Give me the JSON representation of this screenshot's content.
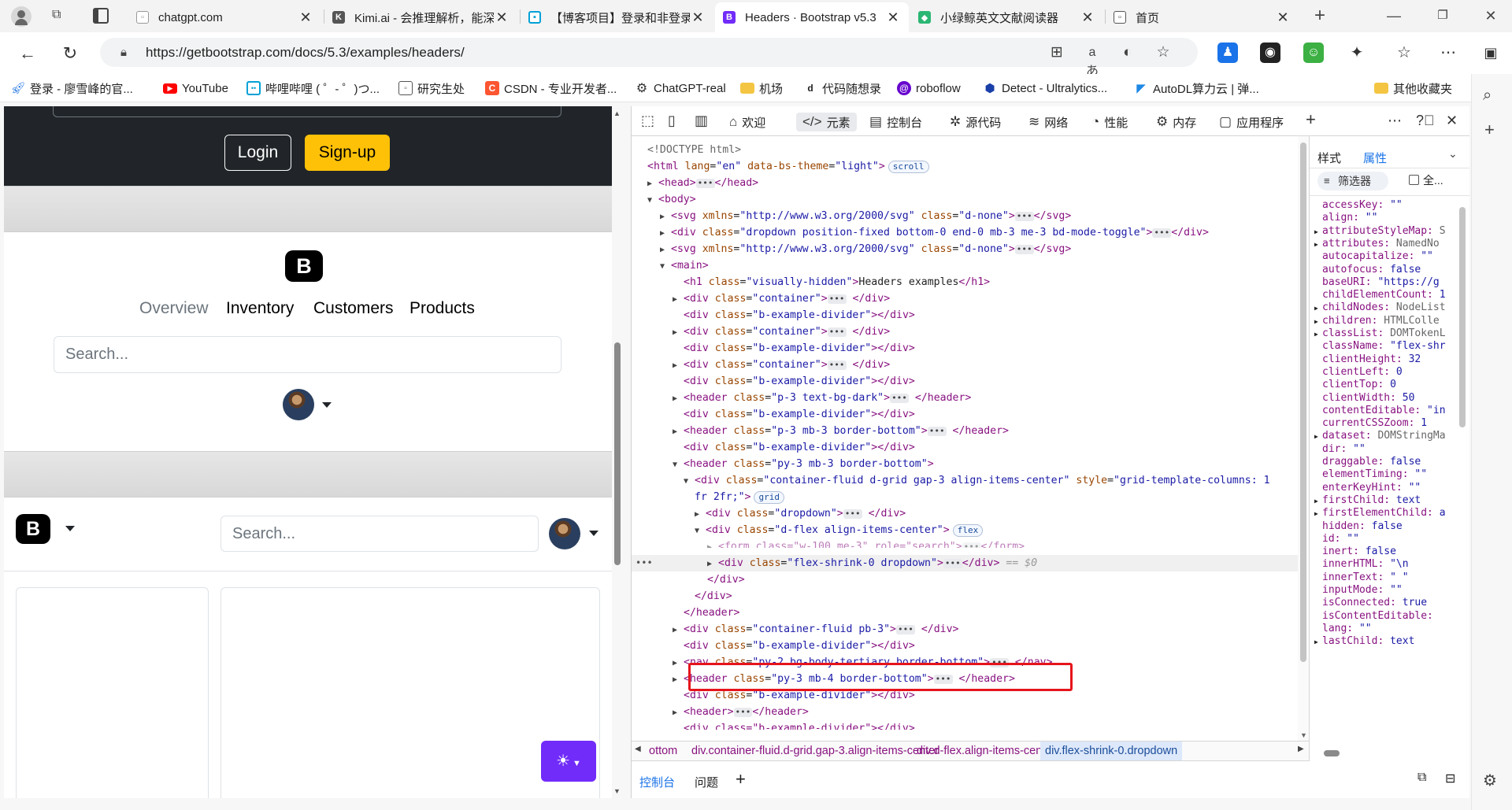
{
  "browser": {
    "tabs": [
      {
        "title": "chatgpt.com",
        "active": false
      },
      {
        "title": "Kimi.ai - 会推理解析，能深度思考",
        "active": false
      },
      {
        "title": "【博客项目】登录和非登录状态",
        "active": false
      },
      {
        "title": "Headers · Bootstrap v5.3",
        "active": true
      },
      {
        "title": "小绿鲸英文文献阅读器",
        "active": false
      },
      {
        "title": "首页",
        "active": false
      }
    ],
    "new_tab": "+",
    "url": "https://getbootstrap.com/docs/5.3/examples/headers/",
    "bookmarks": [
      "登录 - 廖雪峰的官...",
      "YouTube",
      "哔哩哔哩 ( ゜- ゜)つ...",
      "研究生处",
      "CSDN - 专业开发者...",
      "ChatGPT-real",
      "机场",
      "代码随想录",
      "roboflow",
      "Detect - Ultralytics...",
      "AutoDL算力云 | 弹...",
      "其他收藏夹"
    ]
  },
  "page": {
    "login_label": "Login",
    "signup_label": "Sign-up",
    "logo_letter": "B",
    "nav": [
      "Overview",
      "Inventory",
      "Customers",
      "Products"
    ],
    "search_placeholder": "Search...",
    "search_placeholder_2": "Search..."
  },
  "devtools": {
    "tabs": [
      "欢迎",
      "元素",
      "控制台",
      "源代码",
      "网络",
      "性能",
      "内存",
      "应用程序"
    ],
    "active_tab": "元素",
    "side_tabs": [
      "样式",
      "属性"
    ],
    "active_side_tab": "属性",
    "filter_label": "筛选器",
    "show_all_label": "全...",
    "breadcrumbs": [
      "ottom",
      "div.container-fluid.d-grid.gap-3.align-items-center",
      "div.d-flex.align-items-center",
      "div.flex-shrink-0.dropdown"
    ],
    "drawer_tabs": [
      "控制台",
      "问题"
    ],
    "dom_lines": {
      "l0": "<!DOCTYPE html>",
      "l1_tag": "<html",
      "l1_a1": "lang",
      "l1_v1": "\"en\"",
      "l1_a2": "data-bs-theme",
      "l1_v2": "\"light\"",
      "l1_end": ">",
      "l1_badge": "scroll",
      "l2": "<head>",
      "l2_end": "</head>",
      "l3": "<body>",
      "l4_tag": "<svg",
      "l4_a1": "xmlns",
      "l4_v1": "\"http://www.w3.org/2000/svg\"",
      "l4_a2": "class",
      "l4_v2": "\"d-none\"",
      "l4_end": "</svg>",
      "l5_tag": "<div",
      "l5_a1": "class",
      "l5_v1": "\"dropdown position-fixed bottom-0 end-0 mb-3 me-3 bd-mode-toggle\"",
      "l5_end": "</div>",
      "l6_tag": "<svg",
      "l6_a1": "xmlns",
      "l6_v1": "\"http://www.w3.org/2000/svg\"",
      "l6_a2": "class",
      "l6_v2": "\"d-none\"",
      "l6_end": "</svg>",
      "l7": "<main>",
      "l8_tag": "<h1",
      "l8_a1": "class",
      "l8_v1": "\"visually-hidden\"",
      "l8_text": "Headers examples",
      "l8_end": "</h1>",
      "container": "\"container\"",
      "divider": "\"b-example-divider\"",
      "div_open": "<div",
      "div_close": "</div>",
      "header_open": "<header",
      "header_close": "</header>",
      "cls": "class",
      "h1_v": "\"p-3 text-bg-dark\"",
      "h2_v": "\"p-3 mb-3 border-bottom\"",
      "h3_v": "\"py-3 mb-3 border-bottom\"",
      "grid_v": "\"container-fluid d-grid gap-3 align-items-center\"",
      "style_a": "style",
      "style_v1": "\"grid-template-columns: 1",
      "style_v2": "fr 2fr;\"",
      "grid_badge": "grid",
      "dd_v": "\"dropdown\"",
      "flex_v": "\"d-flex align-items-center\"",
      "flex_badge": "flex",
      "form_line": "<form class=\"w-100 me-3\" role=\"search\">",
      "form_end": "</form>",
      "sel_v": "\"flex-shrink-0 dropdown\"",
      "eq0": "== $0",
      "pb_v": "\"container-fluid pb-3\"",
      "nav_open": "<nav",
      "nav_close": "</nav>",
      "nav_v": "\"py-2 bg-body-tertiary border-bottom\"",
      "h4_v": "\"py-3 mb-4 border-bottom\"",
      "header_plain": "<header>",
      "last_line": "<div class=\"b-example-divider\"></div>"
    },
    "properties": [
      {
        "k": "accessKey",
        "v": "\"\"",
        "t": "s",
        "exp": false
      },
      {
        "k": "align",
        "v": "\"\"",
        "t": "s",
        "exp": false
      },
      {
        "k": "attributeStyleMap",
        "v": "S",
        "t": "o",
        "exp": true
      },
      {
        "k": "attributes",
        "v": "NamedNo",
        "t": "o",
        "exp": true
      },
      {
        "k": "autocapitalize",
        "v": "\"\"",
        "t": "s",
        "exp": false
      },
      {
        "k": "autofocus",
        "v": "false",
        "t": "n",
        "exp": false
      },
      {
        "k": "baseURI",
        "v": "\"https://g",
        "t": "s",
        "exp": false
      },
      {
        "k": "childElementCount",
        "v": "1",
        "t": "n",
        "exp": false
      },
      {
        "k": "childNodes",
        "v": "NodeList",
        "t": "o",
        "exp": true
      },
      {
        "k": "children",
        "v": "HTMLColle",
        "t": "o",
        "exp": true
      },
      {
        "k": "classList",
        "v": "DOMTokenL",
        "t": "o",
        "exp": true
      },
      {
        "k": "className",
        "v": "\"flex-shr",
        "t": "s",
        "exp": false
      },
      {
        "k": "clientHeight",
        "v": "32",
        "t": "n",
        "exp": false
      },
      {
        "k": "clientLeft",
        "v": "0",
        "t": "n",
        "exp": false
      },
      {
        "k": "clientTop",
        "v": "0",
        "t": "n",
        "exp": false
      },
      {
        "k": "clientWidth",
        "v": "50",
        "t": "n",
        "exp": false
      },
      {
        "k": "contentEditable",
        "v": "\"in",
        "t": "s",
        "exp": false
      },
      {
        "k": "currentCSSZoom",
        "v": "1",
        "t": "n",
        "exp": false
      },
      {
        "k": "dataset",
        "v": "DOMStringMa",
        "t": "o",
        "exp": true
      },
      {
        "k": "dir",
        "v": "\"\"",
        "t": "s",
        "exp": false
      },
      {
        "k": "draggable",
        "v": "false",
        "t": "n",
        "exp": false
      },
      {
        "k": "elementTiming",
        "v": "\"\"",
        "t": "s",
        "exp": false
      },
      {
        "k": "enterKeyHint",
        "v": "\"\"",
        "t": "s",
        "exp": false
      },
      {
        "k": "firstChild",
        "v": "text",
        "t": "n",
        "exp": true
      },
      {
        "k": "firstElementChild",
        "v": "a",
        "t": "n",
        "exp": true
      },
      {
        "k": "hidden",
        "v": "false",
        "t": "n",
        "exp": false
      },
      {
        "k": "id",
        "v": "\"\"",
        "t": "s",
        "exp": false
      },
      {
        "k": "inert",
        "v": "false",
        "t": "n",
        "exp": false
      },
      {
        "k": "innerHTML",
        "v": "\"\\n",
        "t": "s",
        "exp": false
      },
      {
        "k": "innerText",
        "v": "\" \"",
        "t": "s",
        "exp": false
      },
      {
        "k": "inputMode",
        "v": "\"\"",
        "t": "s",
        "exp": false
      },
      {
        "k": "isConnected",
        "v": "true",
        "t": "n",
        "exp": false
      },
      {
        "k": "isContentEditable",
        "v": "",
        "t": "n",
        "exp": false
      },
      {
        "k": "lang",
        "v": "\"\"",
        "t": "s",
        "exp": false
      },
      {
        "k": "lastChild",
        "v": "text",
        "t": "n",
        "exp": true
      }
    ]
  },
  "colors": {
    "bootstrap_purple": "#712cf9",
    "signup_yellow": "#ffc107",
    "highlight_red": "#e6141c",
    "dark_header": "#212529"
  }
}
